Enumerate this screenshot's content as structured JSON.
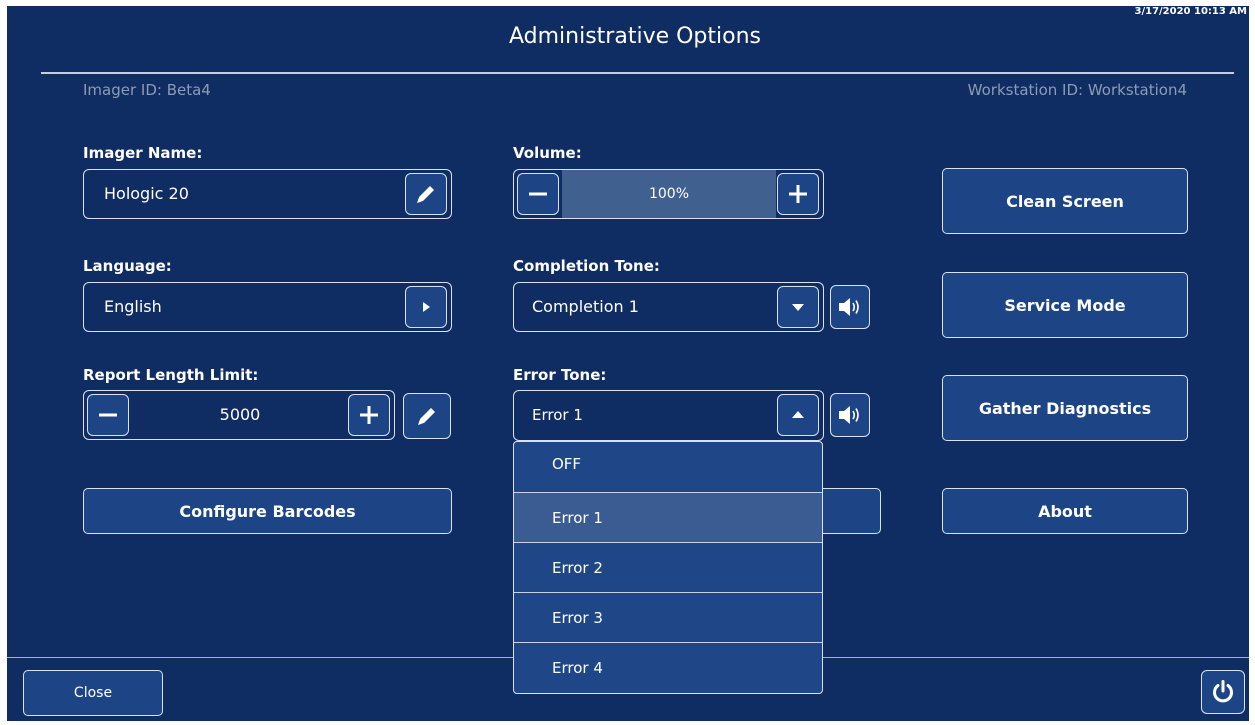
{
  "header": {
    "timestamp": "3/17/2020 10:13 AM",
    "title": "Administrative Options",
    "imager_id": "Imager ID: Beta4",
    "workstation_id": "Workstation ID: Workstation4"
  },
  "imager_name": {
    "label": "Imager Name:",
    "value": "Hologic 20"
  },
  "language": {
    "label": "Language:",
    "value": "English"
  },
  "report_length": {
    "label": "Report Length Limit:",
    "value": "5000"
  },
  "volume": {
    "label": "Volume:",
    "value": "100%",
    "level_percent": 100
  },
  "completion_tone": {
    "label": "Completion Tone:",
    "value": "Completion 1"
  },
  "error_tone": {
    "label": "Error Tone:",
    "value": "Error 1",
    "options": [
      "OFF",
      "Error 1",
      "Error 2",
      "Error 3",
      "Error 4"
    ],
    "selected_index": 1
  },
  "buttons": {
    "configure_barcodes": "Configure Barcodes",
    "clean_screen": "Clean Screen",
    "service_mode": "Service Mode",
    "gather_diagnostics": "Gather Diagnostics",
    "about": "About",
    "close": "Close"
  },
  "icons": {
    "edit": "pencil-icon",
    "arrow": "play-right-icon",
    "dropdown": "caret-down-icon",
    "dropdown_open": "caret-up-icon",
    "speaker": "speaker-icon",
    "minus": "minus-icon",
    "plus": "plus-icon",
    "power": "power-icon"
  },
  "colors": {
    "background": "#0f2d63",
    "button": "#1d4585",
    "selected_option": "#3b5c93",
    "muted_text": "#8d9bb4"
  }
}
